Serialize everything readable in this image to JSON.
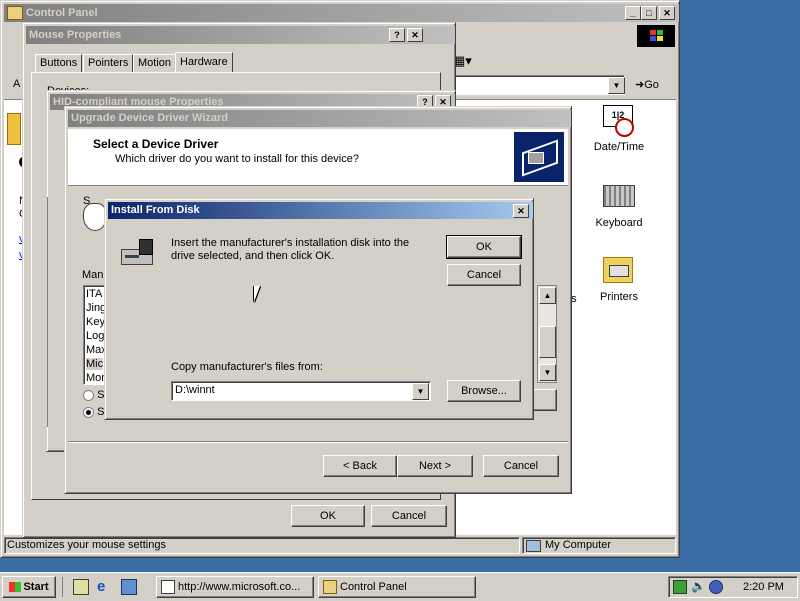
{
  "control_panel": {
    "title": "Control Panel",
    "address_label": "A",
    "go_label": "Go",
    "status_left": "Customizes your mouse settings",
    "status_right": "My Computer",
    "left_pane_fragments": [
      "N",
      "C",
      "v",
      "v"
    ],
    "icons": [
      {
        "label": "Date/Time",
        "icon": "date-time-icon"
      },
      {
        "label": "Keyboard",
        "icon": "keyboard-icon"
      },
      {
        "label": "Printers",
        "icon": "printers-icon"
      }
    ],
    "partial_label": "ns"
  },
  "mouse_props": {
    "title": "Mouse Properties",
    "tabs": [
      "Buttons",
      "Pointers",
      "Motion",
      "Hardware"
    ],
    "active_tab": "Hardware",
    "devices_label": "Devices:",
    "ok": "OK",
    "cancel": "Cancel"
  },
  "hid_props": {
    "title": "HID-compliant mouse Properties"
  },
  "wizard": {
    "title": "Upgrade Device Driver Wizard",
    "heading": "Select a Device Driver",
    "subheading": "Which driver do you want to install for this device?",
    "partial_s": "S",
    "manufacturer_label": "Manu",
    "manufacturers": [
      "ITA",
      "Jing",
      "Key",
      "Log",
      "Max",
      "Mic",
      "Mon"
    ],
    "radio1": "S",
    "radio2": "S",
    "back": "< Back",
    "next": "Next >",
    "cancel": "Cancel"
  },
  "install_disk": {
    "title": "Install From Disk",
    "message": "Insert the manufacturer's installation disk into the drive selected, and then click OK.",
    "ok": "OK",
    "cancel": "Cancel",
    "copy_label": "Copy manufacturer's files from:",
    "path_value": "D:\\winnt",
    "browse": "Browse..."
  },
  "taskbar": {
    "start": "Start",
    "tasks": [
      {
        "label": "http://www.microsoft.co...",
        "icon": "ie-page-icon"
      },
      {
        "label": "Control Panel",
        "icon": "control-panel-icon"
      }
    ],
    "clock": "2:20 PM"
  },
  "colors": {
    "desktop": "#3a6ea5",
    "active_title": "#0a246a",
    "face": "#d4d0c8"
  }
}
